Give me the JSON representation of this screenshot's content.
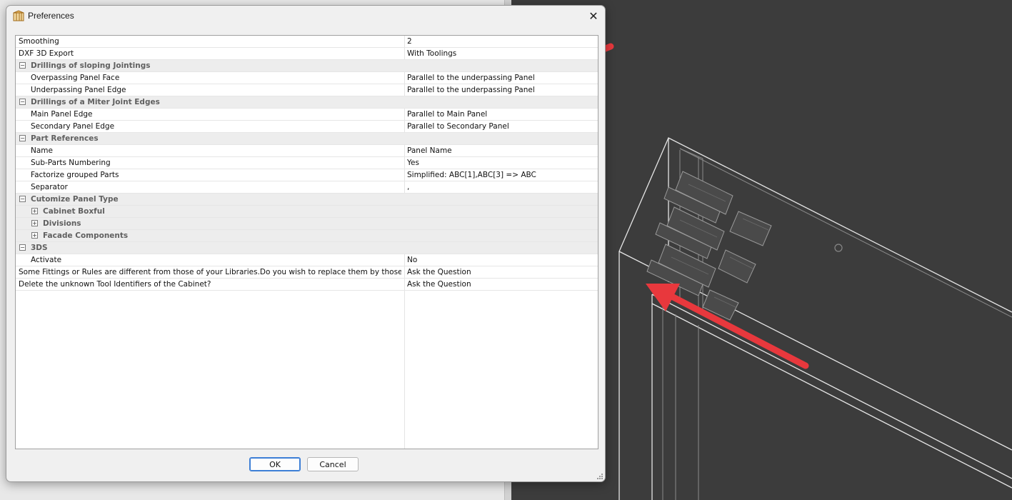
{
  "dialog": {
    "title": "Preferences",
    "close_glyph": "✕",
    "ok_label": "OK",
    "cancel_label": "Cancel",
    "icon": "preferences-app-icon"
  },
  "rows": [
    {
      "kind": "prop",
      "indent": 0,
      "name": "Smoothing",
      "value": "2"
    },
    {
      "kind": "prop",
      "indent": 0,
      "name": "DXF 3D Export",
      "value": "With Toolings"
    },
    {
      "kind": "cat",
      "indent": 0,
      "name": "Drillings of sloping Jointings",
      "toggle": "−"
    },
    {
      "kind": "prop",
      "indent": 1,
      "name": "Overpassing Panel Face",
      "value": "Parallel to the underpassing Panel"
    },
    {
      "kind": "prop",
      "indent": 1,
      "name": "Underpassing Panel Edge",
      "value": "Parallel to the underpassing Panel"
    },
    {
      "kind": "cat",
      "indent": 0,
      "name": "Drillings of a Miter Joint Edges",
      "toggle": "−"
    },
    {
      "kind": "prop",
      "indent": 1,
      "name": "Main Panel Edge",
      "value": "Parallel to Main Panel"
    },
    {
      "kind": "prop",
      "indent": 1,
      "name": "Secondary Panel Edge",
      "value": "Parallel to Secondary Panel"
    },
    {
      "kind": "cat",
      "indent": 0,
      "name": "Part References",
      "toggle": "−"
    },
    {
      "kind": "prop",
      "indent": 1,
      "name": "Name",
      "value": "Panel Name"
    },
    {
      "kind": "prop",
      "indent": 1,
      "name": "Sub-Parts Numbering",
      "value": "Yes"
    },
    {
      "kind": "prop",
      "indent": 1,
      "name": "Factorize grouped Parts",
      "value": "Simplified: ABC[1],ABC[3] => ABC"
    },
    {
      "kind": "prop",
      "indent": 1,
      "name": "Separator",
      "value": ","
    },
    {
      "kind": "cat",
      "indent": 0,
      "name": "Cutomize Panel Type",
      "toggle": "−"
    },
    {
      "kind": "cat",
      "indent": 1,
      "name": "Cabinet Boxful",
      "toggle": "+"
    },
    {
      "kind": "cat",
      "indent": 1,
      "name": "Divisions",
      "toggle": "+"
    },
    {
      "kind": "cat",
      "indent": 1,
      "name": "Facade Components",
      "toggle": "+"
    },
    {
      "kind": "cat",
      "indent": 0,
      "name": "3DS",
      "toggle": "−"
    },
    {
      "kind": "prop",
      "indent": 1,
      "name": "Activate",
      "value": "No"
    },
    {
      "kind": "prop",
      "indent": 0,
      "name": "Some Fittings or Rules are different from those of your Libraries.Do you wish to replace them by those of yo...",
      "value": "Ask the Question"
    },
    {
      "kind": "prop",
      "indent": 0,
      "name": "Delete the unknown Tool Identifiers of the Cabinet?",
      "value": "Ask the Question"
    }
  ],
  "colors": {
    "annotation_arrow": "#e8383d",
    "viewport_bg": "#3c3c3c",
    "wireframe": "#e6e6e6",
    "ok_border": "#3d7fd6"
  }
}
